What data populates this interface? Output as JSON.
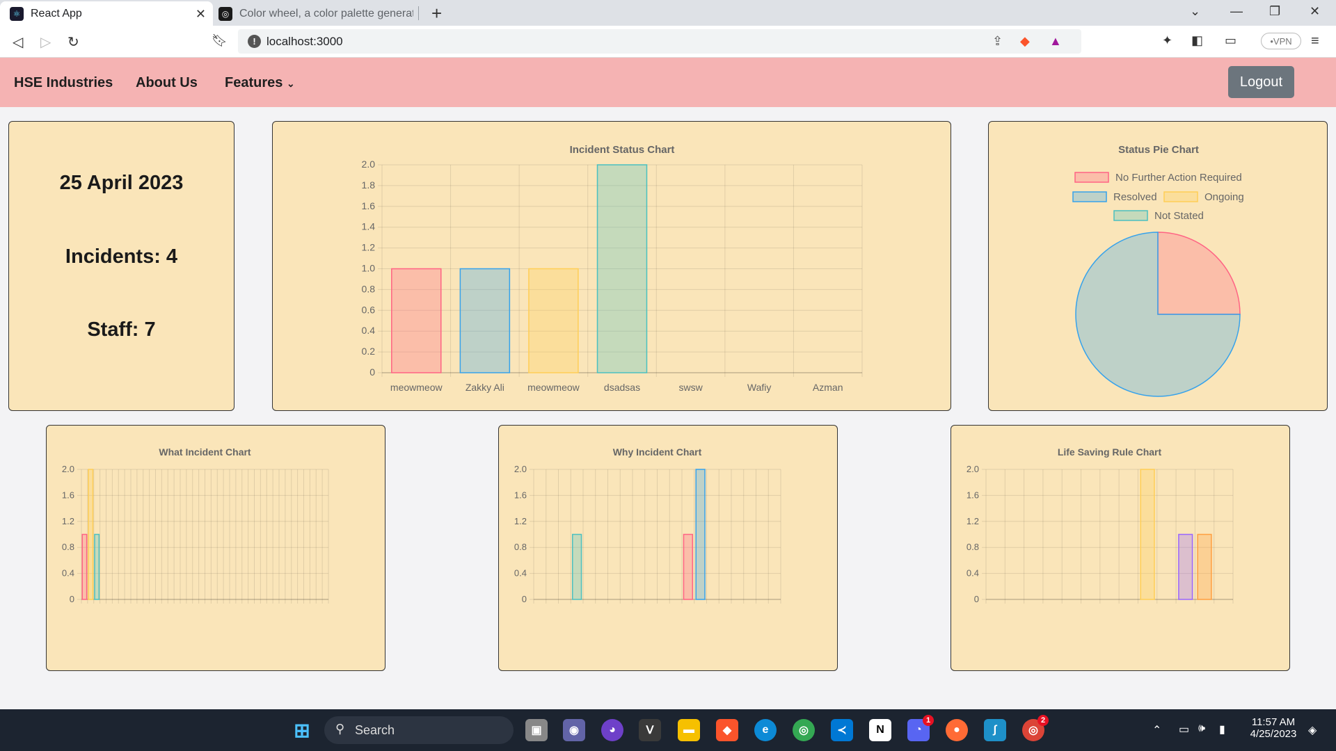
{
  "browser": {
    "tabs": [
      {
        "title": "React App",
        "active": true
      },
      {
        "title": "Color wheel, a color palette generator",
        "active": false
      }
    ],
    "url": "localhost:3000",
    "vpn_label": "VPN"
  },
  "navbar": {
    "brand": "HSE Industries",
    "about": "About Us",
    "features": "Features",
    "logout": "Logout"
  },
  "stats": {
    "date": "25 April 2023",
    "incidents": "Incidents: 4",
    "staff": "Staff: 7"
  },
  "colors": {
    "red": "#ff6384",
    "blue": "#36a2eb",
    "yellow": "#ffce56",
    "teal": "#4bc0c0",
    "purple": "#9966ff",
    "orange": "#ff9f40",
    "card": "#fae5b9",
    "navbar": "#f5b3b3"
  },
  "chart_data": [
    {
      "id": "incident-status",
      "type": "bar",
      "title": "Incident Status Chart",
      "categories": [
        "meowmeow",
        "Zakky Ali",
        "meowmeow",
        "dsadsas",
        "swsw",
        "Wafiy",
        "Azman"
      ],
      "values": [
        1,
        1,
        1,
        2,
        0,
        0,
        0
      ],
      "bar_colors": [
        "red",
        "blue",
        "yellow",
        "teal",
        "purple",
        "orange",
        "red"
      ],
      "ylim": [
        0,
        2
      ],
      "yticks": [
        "2.0",
        "1.8",
        "1.6",
        "1.4",
        "1.2",
        "1.0",
        "0.8",
        "0.6",
        "0.4",
        "0.2",
        "0"
      ],
      "grid": true
    },
    {
      "id": "status-pie",
      "type": "pie",
      "title": "Status Pie Chart",
      "legend": [
        {
          "label": "No Further Action Required",
          "color": "red"
        },
        {
          "label": "Resolved",
          "color": "blue"
        },
        {
          "label": "Ongoing",
          "color": "yellow"
        },
        {
          "label": "Not Stated",
          "color": "teal"
        }
      ],
      "values": [
        1,
        3,
        0,
        0
      ],
      "legend_position": "top"
    },
    {
      "id": "what-incident",
      "type": "bar",
      "title": "What Incident Chart",
      "category_count": 40,
      "bars": [
        {
          "index": 0,
          "value": 1,
          "color": "red"
        },
        {
          "index": 1,
          "value": 2,
          "color": "yellow"
        },
        {
          "index": 2,
          "value": 1,
          "color": "teal"
        }
      ],
      "ylim": [
        0,
        2
      ],
      "yticks": [
        "2.0",
        "1.6",
        "1.2",
        "0.8",
        "0.4",
        "0"
      ],
      "grid": true
    },
    {
      "id": "why-incident",
      "type": "bar",
      "title": "Why Incident Chart",
      "category_count": 20,
      "bars": [
        {
          "index": 3,
          "value": 1,
          "color": "teal"
        },
        {
          "index": 12,
          "value": 1,
          "color": "red"
        },
        {
          "index": 13,
          "value": 2,
          "color": "blue"
        }
      ],
      "ylim": [
        0,
        2
      ],
      "yticks": [
        "2.0",
        "1.6",
        "1.2",
        "0.8",
        "0.4",
        "0"
      ],
      "grid": true
    },
    {
      "id": "life-saving-rule",
      "type": "bar",
      "title": "Life Saving Rule Chart",
      "category_count": 13,
      "bars": [
        {
          "index": 8,
          "value": 2,
          "color": "yellow"
        },
        {
          "index": 10,
          "value": 1,
          "color": "purple"
        },
        {
          "index": 11,
          "value": 1,
          "color": "orange"
        }
      ],
      "ylim": [
        0,
        2
      ],
      "yticks": [
        "2.0",
        "1.6",
        "1.2",
        "0.8",
        "0.4",
        "0"
      ],
      "grid": true
    }
  ],
  "taskbar": {
    "search": "Search",
    "time": "11:57 AM",
    "date": "4/25/2023",
    "badges": {
      "discord": "1",
      "chrome": "2"
    }
  }
}
